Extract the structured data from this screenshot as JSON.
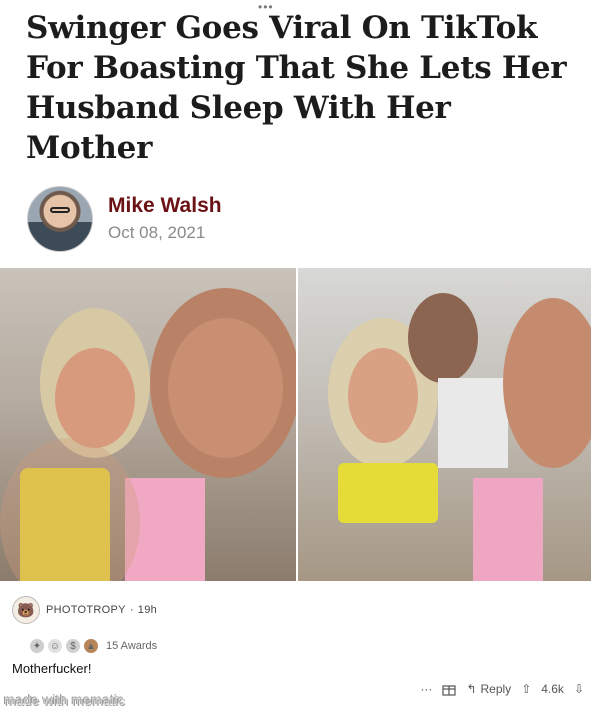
{
  "article": {
    "headline": "Swinger Goes Viral On TikTok For Boasting That She Lets Her Husband Sleep With Her Mother",
    "author": "Mike Walsh",
    "date": "Oct 08, 2021"
  },
  "comment": {
    "username": "PHOTOTROPY",
    "time": "19h",
    "separator": "·",
    "awards_label": "15 Awards",
    "text": "Motherfucker!",
    "more": "···",
    "reply_label": "Reply",
    "score": "4.6k"
  },
  "watermark": "made with mematic",
  "icons": [
    "avatar",
    "award-icon",
    "reply-icon",
    "upvote-icon",
    "downvote-icon",
    "gift-icon",
    "more-icon"
  ]
}
